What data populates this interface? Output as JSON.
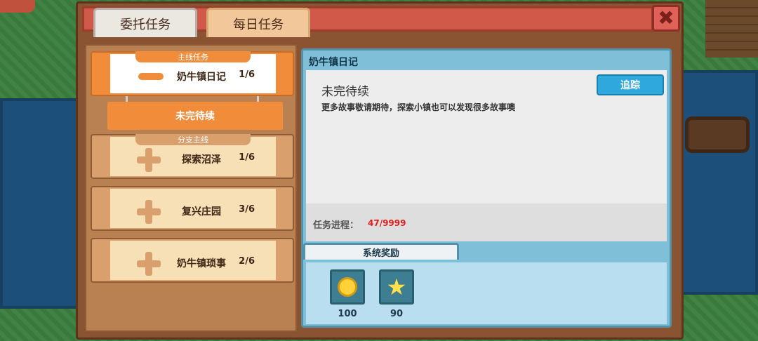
{
  "tabs": {
    "commission": "委托任务",
    "daily": "每日任务"
  },
  "close_icon_glyph": "✖",
  "tasks": [
    {
      "ribbon": "主线任务",
      "name": "奶牛镇日记",
      "count": "1/6",
      "status": "未完待续"
    },
    {
      "ribbon": "分支主线",
      "name": "探索沼泽",
      "count": "1/6"
    },
    {
      "name": "复兴庄园",
      "count": "3/6"
    },
    {
      "name": "奶牛镇琐事",
      "count": "2/6"
    }
  ],
  "detail": {
    "title": "奶牛镇日记",
    "status": "未完待续",
    "description": "更多故事敬请期待，探索小镇也可以发现很多故事噢",
    "track_button": "追踪",
    "progress_label": "任务进程：",
    "progress_value": "47/9999",
    "rewards_tab": "系统奖励",
    "rewards": [
      {
        "icon": "gold-coin-icon",
        "amount": "100"
      },
      {
        "icon": "star-icon",
        "amount": "90"
      }
    ]
  },
  "colors": {
    "accent_orange": "#f18c3a",
    "header_red": "#d0594a",
    "track_blue": "#2fa9dd",
    "progress_red": "#e02020"
  }
}
